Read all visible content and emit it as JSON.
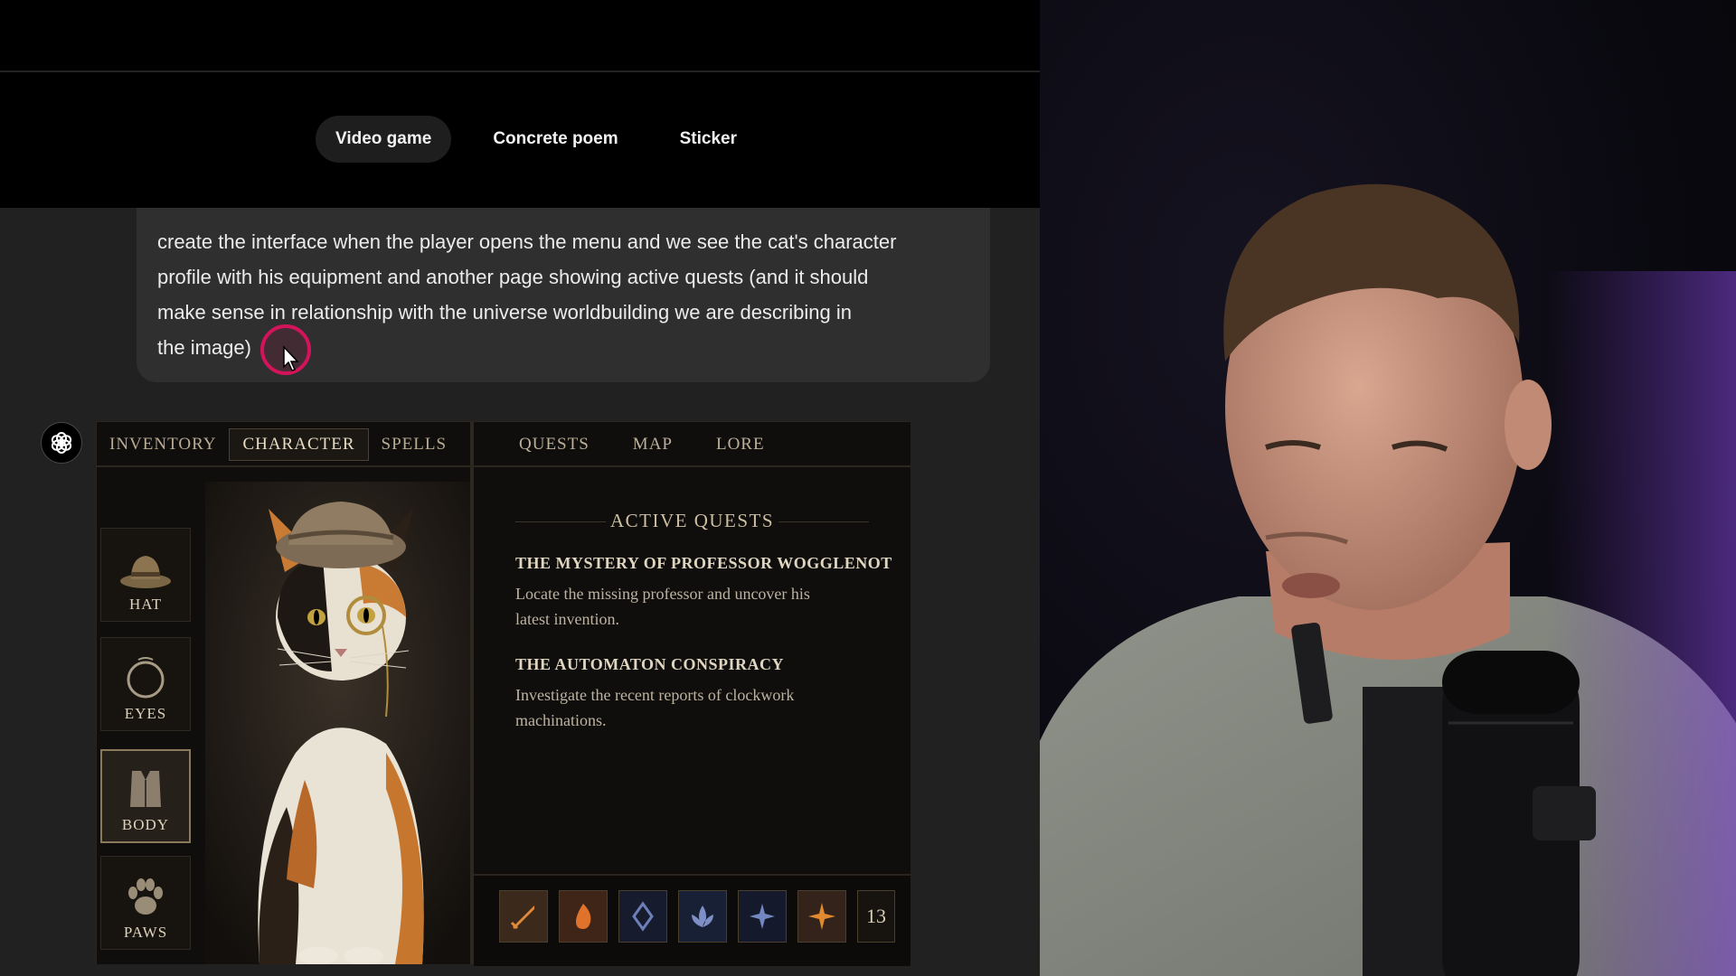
{
  "chip_tabs": [
    {
      "label": "Video game",
      "active": true
    },
    {
      "label": "Concrete poem",
      "active": false
    },
    {
      "label": "Sticker",
      "active": false
    }
  ],
  "prompt": {
    "lines": [
      "create the interface when the player opens the menu and we see the cat's character",
      "profile with his equipment and another page showing active quests (and it should",
      "make sense in relationship with the universe worldbuilding we are describing in",
      "the image)"
    ]
  },
  "game_ui": {
    "left_tabs": [
      {
        "label": "INVENTORY",
        "active": false
      },
      {
        "label": "CHARACTER",
        "active": true
      },
      {
        "label": "SPELLS",
        "active": false
      }
    ],
    "slots": [
      {
        "label": "HAT",
        "icon": "hat-icon",
        "active": false
      },
      {
        "label": "EYES",
        "icon": "monocle-icon",
        "active": false
      },
      {
        "label": "BODY",
        "icon": "coat-icon",
        "active": true
      },
      {
        "label": "PAWS",
        "icon": "paw-icon",
        "active": false
      }
    ],
    "right_tabs": [
      {
        "label": "QUESTS",
        "active": true
      },
      {
        "label": "MAP",
        "active": false
      },
      {
        "label": "LORE",
        "active": false
      }
    ],
    "active_quests_title": "ACTIVE QUESTS",
    "quests": [
      {
        "name": "THE MYSTERY OF PROFESSOR WOGGLENOT",
        "desc_lines": [
          "Locate the missing professor and uncover his",
          "latest invention."
        ]
      },
      {
        "name": "THE AUTOMATON CONSPIRACY",
        "desc_lines": [
          "Investigate the recent reports of clockwork",
          "machinations."
        ]
      }
    ],
    "skills": [
      "sword-icon",
      "flame-icon",
      "rune-icon",
      "lotus-icon",
      "star-icon",
      "sun-icon"
    ],
    "skill_count": "13"
  },
  "colors": {
    "cursor_ring": "#d4145a",
    "game_gold": "#cdbf9f",
    "chat_bg": "#212121",
    "bubble_bg": "#2f2f2f"
  }
}
